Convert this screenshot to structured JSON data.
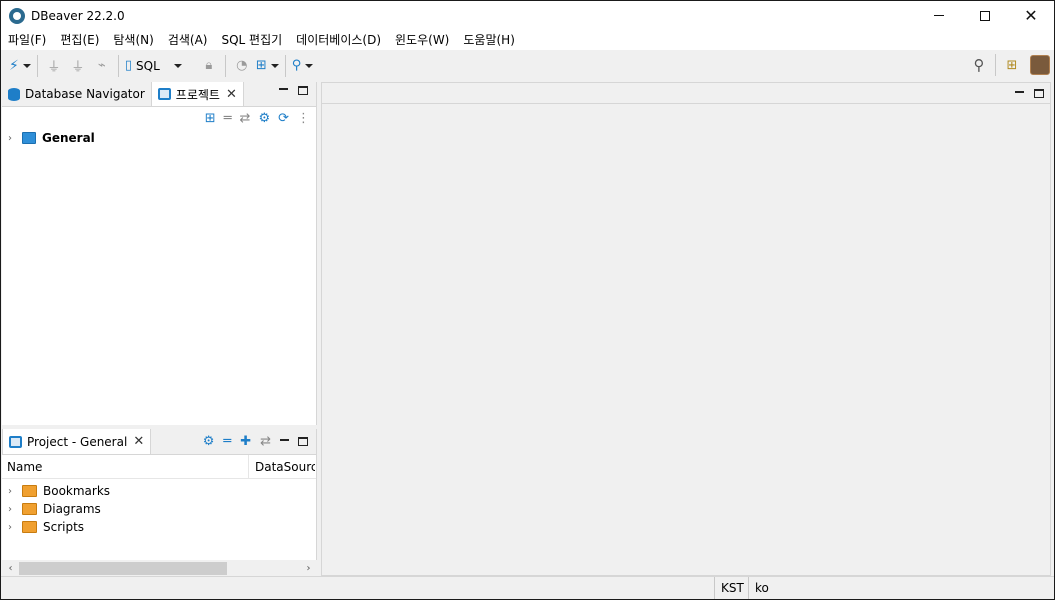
{
  "window": {
    "title": "DBeaver 22.2.0"
  },
  "menu": [
    "파일(F)",
    "편집(E)",
    "탐색(N)",
    "검색(A)",
    "SQL 편집기",
    "데이터베이스(D)",
    "윈도우(W)",
    "도움말(H)"
  ],
  "toolbar": {
    "sql_label": "SQL"
  },
  "top_panel": {
    "tabs": [
      {
        "label": "Database Navigator"
      },
      {
        "label": "프로젝트"
      }
    ],
    "tree": [
      {
        "label": "General"
      }
    ]
  },
  "bottom_panel": {
    "tab_label": "Project - General",
    "columns": [
      "Name",
      "DataSource"
    ],
    "items": [
      {
        "label": "Bookmarks"
      },
      {
        "label": "Diagrams"
      },
      {
        "label": "Scripts"
      }
    ]
  },
  "status": {
    "timezone": "KST",
    "locale": "ko"
  },
  "colors": {
    "accent": "#1e7ec8",
    "folder": "#f0a030"
  }
}
